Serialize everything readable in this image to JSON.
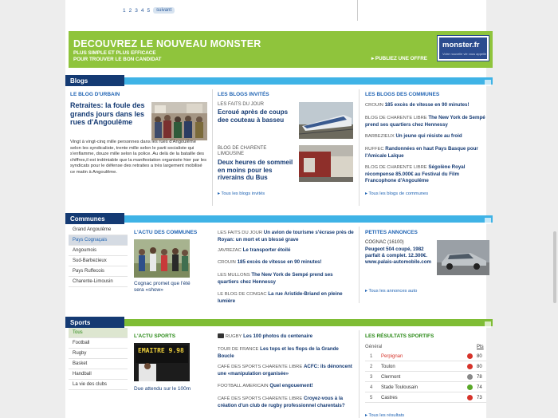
{
  "pagination": {
    "pages": [
      "1",
      "2",
      "3",
      "4",
      "5"
    ],
    "next_label": "suivant"
  },
  "banner": {
    "title": "DECOUVREZ LE NOUVEAU MONSTER",
    "sub1": "PLUS SIMPLE ET PLUS EFFICACE",
    "sub2": "POUR TROUVER LE BON CANDIDAT",
    "publish": "▸ PUBLIEZ UNE OFFRE",
    "logo": "monster.fr",
    "logo_tag": "Votre nouvelle vie vous appelle"
  },
  "blogs": {
    "label": "Blogs",
    "col1_title": "LE BLOG D'URBAIN",
    "col1_head": "Retraites: la foule des grands jours dans les rues d'Angoulême",
    "col1_text": "Vingt à vingt-cinq mille personnes dans les rues d'Angoulême selon les syndicaliste, trente mille selon le parti socialiste qui s'enflamme, douze mille selon la police. Au delà de la bataille des chiffres,il est indéniable que la manifestation organisée hier par les syndicats pour le défense des retraites a très largement mobilisé ce matin à Angoulême.",
    "col2_title": "LES BLOGS INVITÉS",
    "col2_lbl1": "LES FAITS DU JOUR",
    "col2_head1": "Ecroué après de coups dee couteau à basseu",
    "col2_lbl2": "BLOG DE CHARENTE LIMOUSINE",
    "col2_head2": "Deux heures de sommeil en moins pour les riverains du Bus",
    "col2_more": "Tous les blogs invités",
    "col3_title": "LES BLOGS DES COMMUNES",
    "col3_items": [
      {
        "src": "CROUIN",
        "text": "185 excès de vitesse en 90 minutes!"
      },
      {
        "src": "BLOG DE CHARENTE LIBRE",
        "text": "The New York de Sempé prend ses quartiers chez Hennessy"
      },
      {
        "src": "BARBEZIEUX",
        "text": "Un jeune qui résiste au froid"
      },
      {
        "src": "RUFFEC",
        "text": "Randonnées en haut Pays Basque pour l'Amicale Laïque"
      },
      {
        "src": "BLOG DE CHARENTE LIBRE",
        "text": "Ségolène Royal récompense 85.000€ au Festival du Film Francophone d'Angoulême"
      }
    ],
    "col3_more": "Tous les blogs de communes"
  },
  "communes": {
    "label": "Communes",
    "nav": [
      "Grand Angoulême",
      "Pays Cognaçais",
      "Angoumois",
      "Sud-Barbezieux",
      "Pays Ruffecois",
      "Charente-Limousin"
    ],
    "actu_title": "L'ACTU DES COMMUNES",
    "actu_caption": "Cognac promet que l'été sera «show»",
    "items": [
      {
        "src": "LES FAITS DU JOUR",
        "text": "Un avion de tourisme s'écrase près de Royan: un mort et un blessé grave"
      },
      {
        "src": "JAVREZAC",
        "text": "Le transporter étoilé"
      },
      {
        "src": "CROUIN",
        "text": "185 excès de vitesse en 90 minutes!"
      },
      {
        "src": "LES MULLONS",
        "text": "The New York de Sempé prend ses quartiers chez Hennessy"
      },
      {
        "src": "LE BLOG DE CONGAC",
        "text": "La rue Aristide-Briand en pleine lumière"
      }
    ],
    "ads_title": "PETITES ANNONCES",
    "ads_tabs": [
      "Auto",
      "Immo",
      "Emploi"
    ],
    "ad_loc": "COGNAC (16100)",
    "ad_text": "Peugeot 504 coupé, 1982 parfait & complet. 12.300€. www.palais-automobile.com",
    "ads_more": "Tous les annonces auto"
  },
  "sports": {
    "label": "Sports",
    "nav": [
      "Tous",
      "Football",
      "Rugby",
      "Basket",
      "Handball",
      "La vie des clubs"
    ],
    "actu_title": "L'ACTU SPORTS",
    "actu_caption": "Due attendu sur le 100m",
    "scoreboard_text": "EMAITRE 9.98",
    "items": [
      {
        "src": "RUGBY",
        "text": "Les 100 photos du centenaire"
      },
      {
        "src": "TOUR DE FRANCE",
        "text": "Les tops et les flops de la Grande Boucle"
      },
      {
        "src": "CAFÉ DES SPORTS CHARENTE LIBRE",
        "text": "ACFC: ils dénoncent une «manipulation organisée»"
      },
      {
        "src": "FOOTBALL AMERICAIN",
        "text": "Quel engouement!"
      },
      {
        "src": "CAFÉ DES SPORTS CHARENTE LIBRE",
        "text": "Croyez-vous à la création d'un club de rugby professionnel charentais?"
      }
    ],
    "results_title": "LES RÉSULTATS SPORTIFS",
    "results_header": "Général",
    "results_pts": "Pts",
    "results": [
      {
        "rank": "1",
        "team": "Perpignan",
        "pts": "80",
        "trend": "down"
      },
      {
        "rank": "2",
        "team": "Toulon",
        "pts": "80",
        "trend": "down"
      },
      {
        "rank": "3",
        "team": "Clermont",
        "pts": "78",
        "trend": "none"
      },
      {
        "rank": "4",
        "team": "Stade Toulousain",
        "pts": "74",
        "trend": "up"
      },
      {
        "rank": "5",
        "team": "Castres",
        "pts": "73",
        "trend": "down"
      }
    ],
    "results_more": "Tous les résultats"
  },
  "colors": {
    "navy": "#143a73",
    "blue": "#3fb3e6",
    "green": "#7fbd35",
    "link": "#1f63b3",
    "red": "#d6332a"
  }
}
